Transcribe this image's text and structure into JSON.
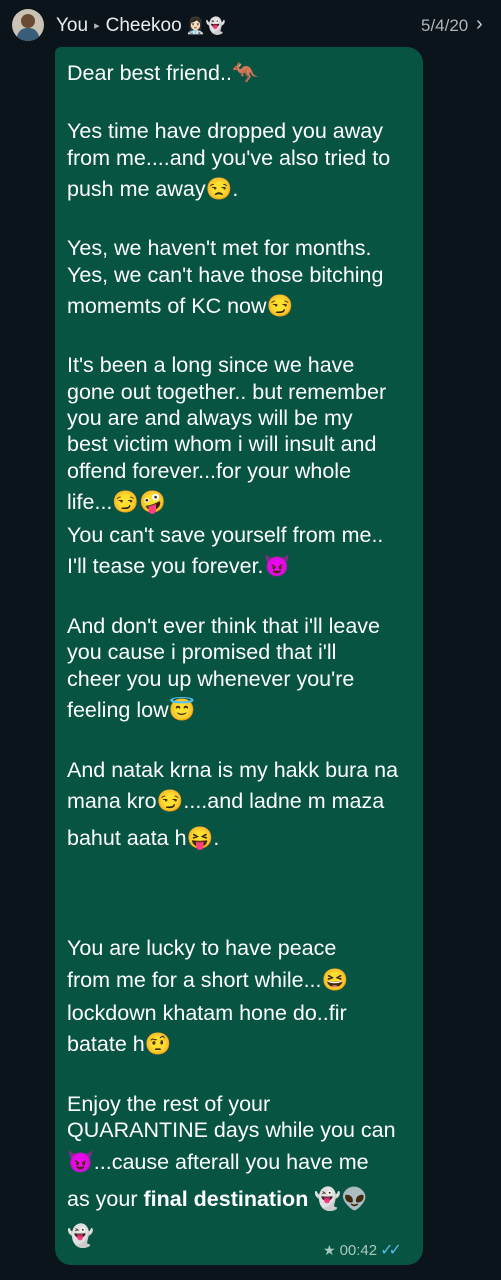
{
  "header": {
    "sender": "You",
    "separator": "▸",
    "recipient": "Cheekoo",
    "recipient_emoji": "👩🏻‍⚕️👻",
    "date": "5/4/20",
    "chevron": "›"
  },
  "message": {
    "lines": [
      "Dear best friend..🦘",
      "Yes time have dropped you away",
      "from me....and you've also tried to",
      "push me away😒.",
      "Yes, we haven't met for months.",
      "Yes, we can't have those bitching",
      "momemts of KC now😏",
      "It's been a long since we have",
      "gone out together.. but remember",
      "you are and always will be my",
      "best victim whom i will insult and",
      "offend forever...for your whole",
      "life...😏🤪",
      "You can't save yourself from me..",
      "I'll tease you forever.😈",
      "And don't ever think that i'll leave",
      "you cause i promised that i'll",
      "cheer you up whenever you're",
      "feeling low😇",
      "And natak krna is my hakk bura na",
      "mana kro😏....and ladne m maza",
      "bahut aata h😝.",
      "You are lucky to have peace",
      "from me for a short while...😆",
      "lockdown khatam hone do..fir",
      "batate h🤨",
      "Enjoy the rest of your",
      "QUARANTINE days while you can",
      "😈...cause afterall you have me",
      "as your ",
      "👻"
    ],
    "bold_phrase": "final destination",
    "bold_tail_emoji": " 👻👽",
    "time": "00:42",
    "starred": "★",
    "read_ticks": "✓✓"
  },
  "colors": {
    "background": "#0b141a",
    "bubble": "#075443",
    "text": "#ffffff",
    "meta": "#a8c8bf",
    "read_ticks": "#53bdeb"
  },
  "icons": [
    "contact-avatar",
    "chevron-right-icon",
    "star-icon",
    "double-check-icon"
  ]
}
